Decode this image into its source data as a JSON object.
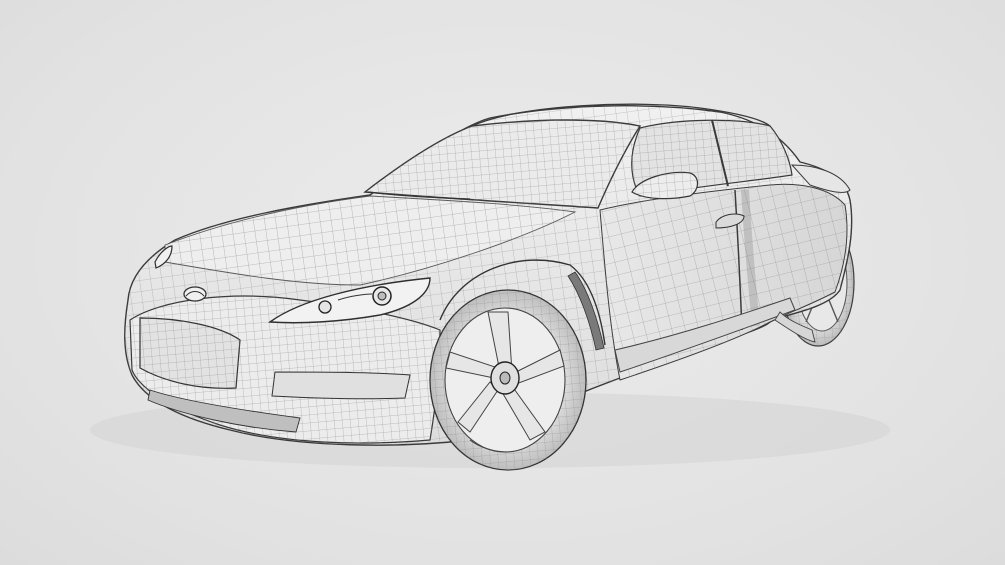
{
  "scene": {
    "subject": "car-wireframe-model",
    "background_color": "#e4e4e4",
    "body_color": "#e9e9e9",
    "wire_color": "#8a8a8a",
    "outline_color": "#3c3c3c",
    "shadow_color": "#cfcfcf"
  }
}
